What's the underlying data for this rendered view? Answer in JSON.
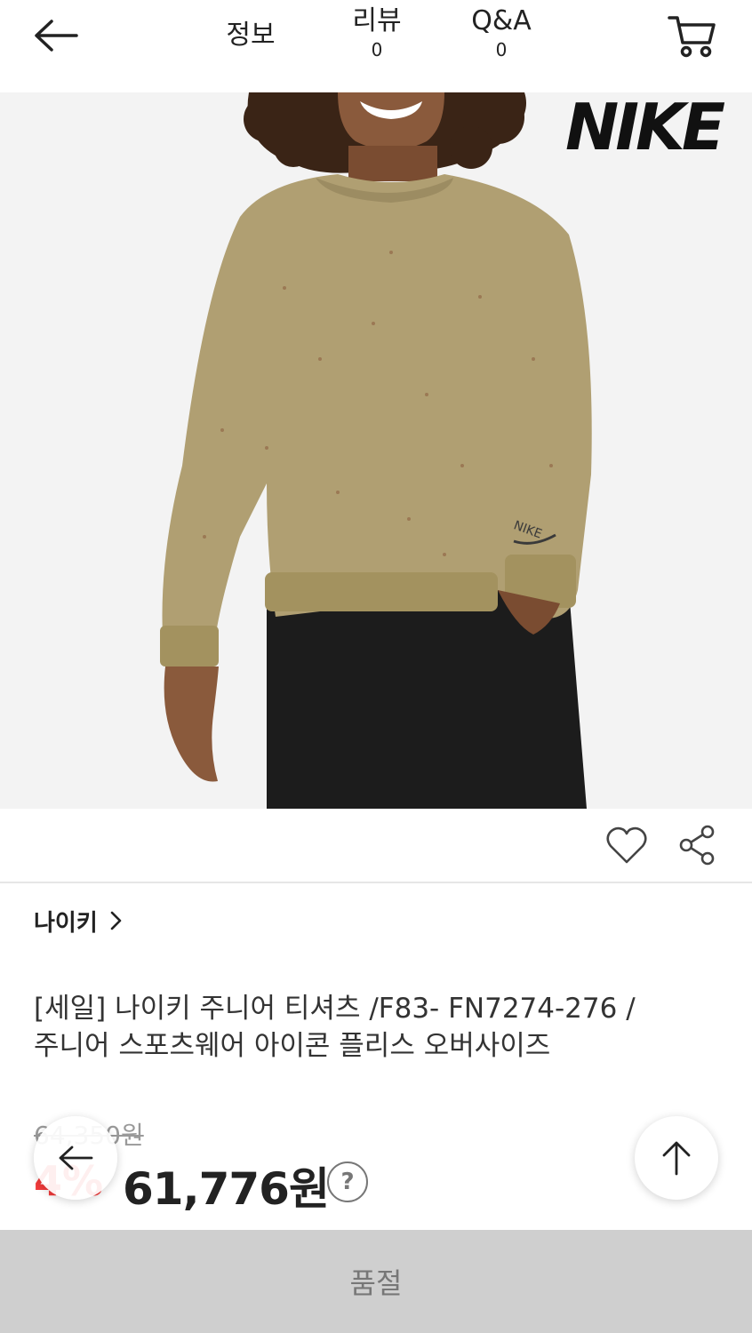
{
  "header": {
    "tabs": [
      {
        "label": "정보"
      },
      {
        "label": "리뷰",
        "count": "0"
      },
      {
        "label": "Q&A",
        "count": "0"
      }
    ]
  },
  "hero": {
    "brand_logo": "NIKE",
    "description_colors": {
      "sweatshirt": "#b09f72",
      "pants": "#1c1c1c",
      "background": "#f3f3f3"
    }
  },
  "product": {
    "brand": "나이키",
    "title_line1": "[세일] 나이키 주니어 티셔츠 /F83- FN7274-276 /",
    "title_line2": "주니어 스포츠웨어 아이콘 플리스 오버사이즈",
    "original_price": "64,350원",
    "discount": "4%",
    "sale_price": "61,776원",
    "help_symbol": "?"
  },
  "bottom": {
    "soldout_label": "품절"
  },
  "icons": {
    "back": "arrow-left-icon",
    "cart": "cart-icon",
    "like": "heart-icon",
    "share": "share-icon",
    "scroll_top": "arrow-up-icon",
    "help": "question-circle-icon"
  },
  "colors": {
    "discount_red": "#f23b3b",
    "text_dark": "#222222",
    "soldout_bg": "#cfcfcf"
  }
}
